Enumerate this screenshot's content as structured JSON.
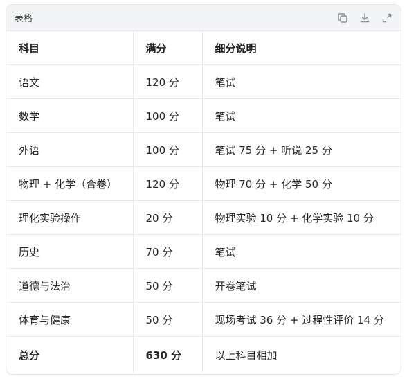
{
  "card": {
    "title": "表格",
    "actions": [
      {
        "name": "copy-icon"
      },
      {
        "name": "download-icon"
      },
      {
        "name": "expand-icon"
      }
    ]
  },
  "table": {
    "headers": [
      "科目",
      "满分",
      "细分说明"
    ],
    "rows": [
      [
        "语文",
        "120 分",
        "笔试"
      ],
      [
        "数学",
        "100 分",
        "笔试"
      ],
      [
        "外语",
        "100 分",
        "笔试 75 分 + 听说 25 分"
      ],
      [
        "物理 + 化学（合卷）",
        "120 分",
        "物理 70 分 + 化学 50 分"
      ],
      [
        "理化实验操作",
        "20 分",
        "物理实验 10 分 + 化学实验 10 分"
      ],
      [
        "历史",
        "70 分",
        "笔试"
      ],
      [
        "道德与法治",
        "50 分",
        "开卷笔试"
      ],
      [
        "体育与健康",
        "50 分",
        "现场考试 36 分 + 过程性评价 14 分"
      ]
    ],
    "total": [
      "总分",
      "630 分",
      "以上科目相加"
    ]
  }
}
